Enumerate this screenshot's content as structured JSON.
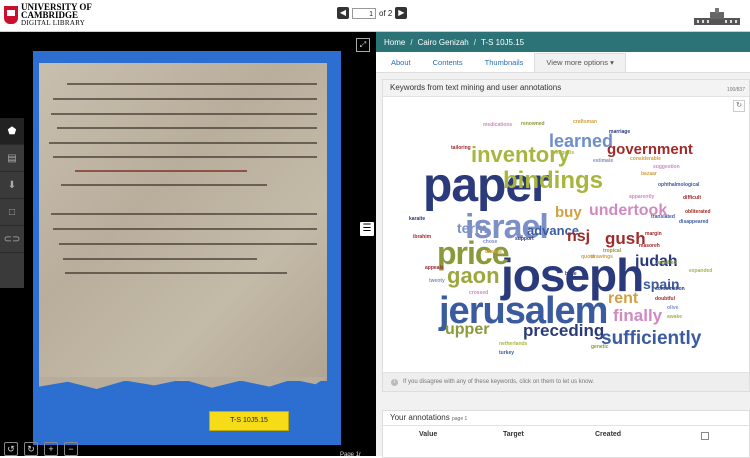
{
  "header": {
    "logo_line1": "UNIVERSITY OF",
    "logo_line2": "CAMBRIDGE",
    "logo_line3": "DIGITAL LIBRARY",
    "page_current": "1",
    "page_of": "of 2"
  },
  "viewer": {
    "shelfmark_label": "T-S 10J5.15",
    "page_label": "Page 1r"
  },
  "breadcrumb": [
    "Home",
    "Cairo Genizah",
    "T-S 10J5.15"
  ],
  "tabs": [
    "About",
    "Contents",
    "Thumbnails",
    "View more options"
  ],
  "keywords_card": {
    "title": "Keywords from text mining and user annotations",
    "count": "100/837",
    "info_text": "If you disagree with any of these keywords, click on them to let us know.",
    "words": [
      {
        "t": "paper",
        "c": "#2b3a7a"
      },
      {
        "t": "joseph",
        "c": "#2b3a7a"
      },
      {
        "t": "jerusalem",
        "c": "#3b5ba0"
      },
      {
        "t": "israel",
        "c": "#7d8fc7"
      },
      {
        "t": "price",
        "c": "#8a9a3a"
      },
      {
        "t": "inventory",
        "c": "#a8b640"
      },
      {
        "t": "bindings",
        "c": "#a8b640"
      },
      {
        "t": "learned",
        "c": "#6d8ecb"
      },
      {
        "t": "government",
        "c": "#a22a2a"
      },
      {
        "t": "undertook",
        "c": "#d08ac0"
      },
      {
        "t": "buy",
        "c": "#d2a040"
      },
      {
        "t": "gaon",
        "c": "#9aa840"
      },
      {
        "t": "advance",
        "c": "#3b5ba0"
      },
      {
        "t": "term",
        "c": "#7d8fc7"
      },
      {
        "t": "nsj",
        "c": "#a22a2a"
      },
      {
        "t": "gush",
        "c": "#a22a2a"
      },
      {
        "t": "judah",
        "c": "#2b3a7a"
      },
      {
        "t": "spain",
        "c": "#3b5ba0"
      },
      {
        "t": "rent",
        "c": "#d2a040"
      },
      {
        "t": "finally",
        "c": "#d08ac0"
      },
      {
        "t": "upper",
        "c": "#8a9a3a"
      },
      {
        "t": "preceding",
        "c": "#2b3a7a"
      },
      {
        "t": "sufficiently",
        "c": "#3b5ba0"
      },
      {
        "t": "medications",
        "c": "#d08ac0"
      },
      {
        "t": "craftsman",
        "c": "#d2a040"
      },
      {
        "t": "renowned",
        "c": "#8a9a3a"
      },
      {
        "t": "tailoring",
        "c": "#a22a2a"
      },
      {
        "t": "marriage",
        "c": "#2b3a7a"
      },
      {
        "t": "considerable",
        "c": "#d2a040"
      },
      {
        "t": "estimate",
        "c": "#7d8fc7"
      },
      {
        "t": "exegesis",
        "c": "#a8b640"
      },
      {
        "t": "suggestion",
        "c": "#d08ac0"
      },
      {
        "t": "bazaar",
        "c": "#d2a040"
      },
      {
        "t": "ophthalmological",
        "c": "#3b5ba0"
      },
      {
        "t": "difficult",
        "c": "#a22a2a"
      },
      {
        "t": "obliterated",
        "c": "#a22a2a"
      },
      {
        "t": "disappeared",
        "c": "#3b5ba0"
      },
      {
        "t": "support",
        "c": "#2b3a7a"
      },
      {
        "t": "appeals",
        "c": "#a22a2a"
      },
      {
        "t": "twenty",
        "c": "#7d8fc7"
      },
      {
        "t": "crossed",
        "c": "#d08ac0"
      },
      {
        "t": "unskilled",
        "c": "#8a9a3a"
      },
      {
        "t": "expanded",
        "c": "#a8b640"
      },
      {
        "t": "combination",
        "c": "#2b3a7a"
      },
      {
        "t": "doubtful",
        "c": "#a22a2a"
      },
      {
        "t": "netherlands",
        "c": "#a8b640"
      },
      {
        "t": "turkey",
        "c": "#3b5ba0"
      },
      {
        "t": "genetic",
        "c": "#8a9a3a"
      },
      {
        "t": "quota",
        "c": "#d2a040"
      },
      {
        "t": "karaite",
        "c": "#2b3a7a"
      },
      {
        "t": "ibrahim",
        "c": "#a22a2a"
      },
      {
        "t": "chose",
        "c": "#7d8fc7"
      },
      {
        "t": "cheese",
        "c": "#d2a040"
      },
      {
        "t": "translated",
        "c": "#3b5ba0"
      },
      {
        "t": "masoreh",
        "c": "#a22a2a"
      },
      {
        "t": "apparently",
        "c": "#d08ac0"
      },
      {
        "t": "tropical",
        "c": "#8a9a3a"
      },
      {
        "t": "bible",
        "c": "#2b3a7a"
      },
      {
        "t": "margin",
        "c": "#a22a2a"
      },
      {
        "t": "drawings",
        "c": "#d2a040"
      },
      {
        "t": "olive",
        "c": "#7d8fc7"
      },
      {
        "t": "awake",
        "c": "#a8b640"
      }
    ]
  },
  "annotations_card": {
    "title": "Your annotations",
    "page": "page 1",
    "columns": [
      "Value",
      "Target",
      "Created"
    ]
  }
}
